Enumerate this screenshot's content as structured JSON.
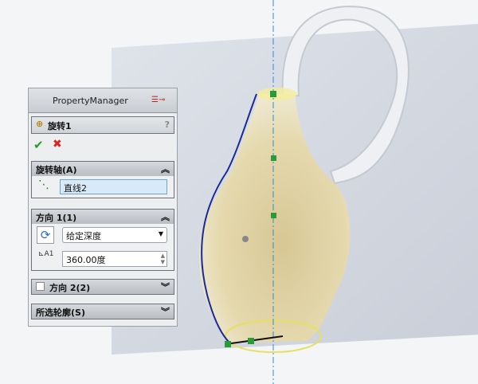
{
  "property_manager": {
    "header": "PropertyManager",
    "feature_title": "旋转1",
    "help": "?",
    "ok": "✔",
    "cancel": "✖",
    "axis_section": {
      "label": "旋转轴(A)",
      "value": "直线2"
    },
    "direction1": {
      "label": "方向 1(1)",
      "end_condition": "给定深度",
      "angle": "360.00度"
    },
    "direction2": {
      "label": "方向 2(2)",
      "checked": false
    },
    "contours": {
      "label": "所选轮廓(S)"
    }
  }
}
